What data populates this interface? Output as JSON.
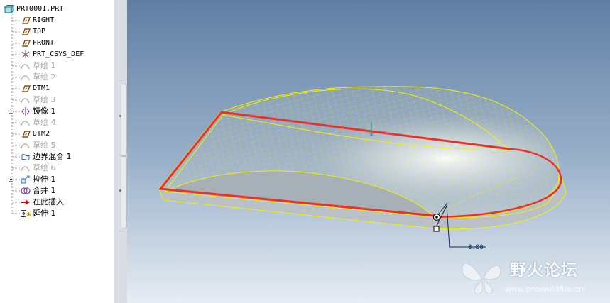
{
  "model_tree": {
    "root": "PRT0001.PRT",
    "items": [
      {
        "label": "RIGHT",
        "icon": "datum-plane-icon",
        "dim": false,
        "expandable": false
      },
      {
        "label": "TOP",
        "icon": "datum-plane-icon",
        "dim": false,
        "expandable": false
      },
      {
        "label": "FRONT",
        "icon": "datum-plane-icon",
        "dim": false,
        "expandable": false
      },
      {
        "label": "PRT_CSYS_DEF",
        "icon": "csys-icon",
        "dim": false,
        "expandable": false
      },
      {
        "label": "草绘 1",
        "icon": "sketch-icon",
        "dim": true,
        "expandable": false
      },
      {
        "label": "草绘 2",
        "icon": "sketch-icon",
        "dim": true,
        "expandable": false
      },
      {
        "label": "DTM1",
        "icon": "datum-plane-icon",
        "dim": false,
        "expandable": false
      },
      {
        "label": "草绘 3",
        "icon": "sketch-icon",
        "dim": true,
        "expandable": false
      },
      {
        "label": "镜像 1",
        "icon": "mirror-icon",
        "dim": false,
        "expandable": true
      },
      {
        "label": "草绘 4",
        "icon": "sketch-icon",
        "dim": true,
        "expandable": false
      },
      {
        "label": "DTM2",
        "icon": "datum-plane-icon",
        "dim": false,
        "expandable": false
      },
      {
        "label": "草绘 5",
        "icon": "sketch-icon",
        "dim": true,
        "expandable": false
      },
      {
        "label": "边界混合 1",
        "icon": "boundary-blend-icon",
        "dim": false,
        "expandable": false
      },
      {
        "label": "草绘 6",
        "icon": "sketch-icon",
        "dim": true,
        "expandable": false
      },
      {
        "label": "拉伸 1",
        "icon": "extrude-icon",
        "dim": false,
        "expandable": true
      },
      {
        "label": "合并 1",
        "icon": "merge-icon",
        "dim": false,
        "expandable": false
      },
      {
        "label": "在此插入",
        "icon": "insert-here-arrow-icon",
        "dim": false,
        "expandable": false
      },
      {
        "label": "延伸 1",
        "icon": "extend-icon",
        "dim": false,
        "expandable": false
      }
    ]
  },
  "dimension": {
    "value": "8.00"
  },
  "watermark": {
    "title": "野火论坛",
    "url": "www.proewildfire.cn"
  },
  "colors": {
    "background_top": "#5f7ea3",
    "background_bottom": "#e7edf4",
    "mesh": "#f2f200",
    "highlight_edge": "#e8322a",
    "dimension": "#0b2a55"
  }
}
